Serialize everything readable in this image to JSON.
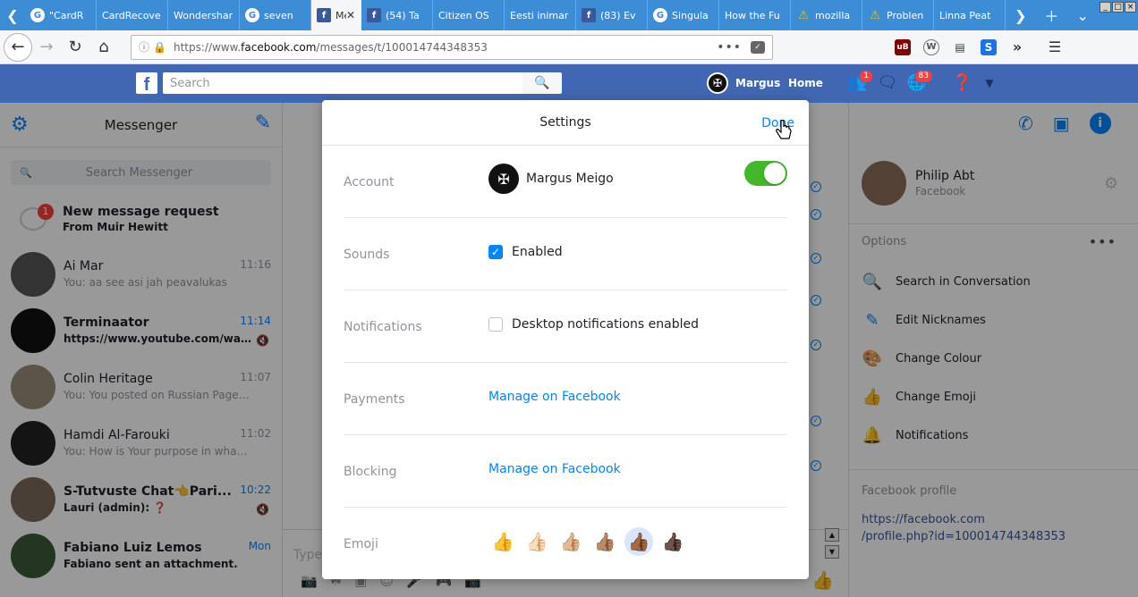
{
  "browser": {
    "tabs": [
      {
        "label": "\"CardR",
        "icon": "google-icon",
        "active": false
      },
      {
        "label": "CardRecove",
        "icon": "",
        "active": false
      },
      {
        "label": "Wondershar",
        "icon": "",
        "active": false
      },
      {
        "label": "seven",
        "icon": "google-icon",
        "active": false
      },
      {
        "label": "Me",
        "icon": "facebook-icon",
        "active": true
      },
      {
        "label": "(54) Ta",
        "icon": "facebook-icon",
        "active": false
      },
      {
        "label": "Citizen OS",
        "icon": "",
        "active": false
      },
      {
        "label": "Eesti inimar",
        "icon": "",
        "active": false
      },
      {
        "label": "(83) Ev",
        "icon": "facebook-icon",
        "active": false
      },
      {
        "label": "Singula",
        "icon": "google-icon",
        "active": false
      },
      {
        "label": "How the Fu",
        "icon": "",
        "active": false
      },
      {
        "label": "mozilla",
        "icon": "warning-icon",
        "active": false
      },
      {
        "label": "Problen",
        "icon": "warning-icon",
        "active": false
      },
      {
        "label": "Linna Peat",
        "icon": "",
        "active": false
      }
    ],
    "url_prefix": "https://www.",
    "url_domain": "facebook.com",
    "url_path": "/messages/t/100014744348353"
  },
  "fb": {
    "search_placeholder": "Search",
    "user_name": "Margus",
    "home_label": "Home",
    "friend_requests_badge": "1",
    "notifications_badge": "83"
  },
  "messenger": {
    "title": "Messenger",
    "search_placeholder": "Search Messenger",
    "request": {
      "badge": "1",
      "title": "New message request",
      "from": "From Muir Hewitt"
    },
    "conversations": [
      {
        "name": "Ai Mar",
        "snippet": "You: aa see asi jah peavalukas",
        "time": "11:16",
        "unread": false,
        "color": "#555"
      },
      {
        "name": "Terminaator",
        "snippet": "https://www.youtube.com/watc...",
        "time": "11:14",
        "unread": true,
        "color": "#111"
      },
      {
        "name": "Colin Heritage",
        "snippet": "You: You posted on Russian Page ...",
        "time": "11:07",
        "unread": false,
        "color": "#9a8a7a"
      },
      {
        "name": "Hamdi Al-Farouki",
        "snippet": "You: How is Your purpose in what ...",
        "time": "11:02",
        "unread": false,
        "color": "#222"
      },
      {
        "name": "S-Tutvuste Chat👈Pari...",
        "snippet": "Lauri (admin): ❓",
        "time": "10:22",
        "unread": true,
        "color": "#7a6a5a"
      },
      {
        "name": "Fabiano Luiz Lemos",
        "snippet": "Fabiano sent an attachment.",
        "time": "Mon",
        "unread": true,
        "color": "#3a5a3a"
      }
    ],
    "composer_placeholder": "Type"
  },
  "settings": {
    "title": "Settings",
    "done_label": "Done",
    "account_label": "Account",
    "account_name": "Margus Meigo",
    "sounds_label": "Sounds",
    "sounds_value": "Enabled",
    "notifications_label": "Notifications",
    "notifications_value": "Desktop notifications enabled",
    "payments_label": "Payments",
    "payments_link": "Manage on Facebook",
    "blocking_label": "Blocking",
    "blocking_link": "Manage on Facebook",
    "emoji_label": "Emoji",
    "emoji_options": [
      "👍",
      "👍🏻",
      "👍🏼",
      "👍🏽",
      "👍🏾",
      "👍🏿"
    ]
  },
  "info_panel": {
    "contact_name": "Philip Abt",
    "contact_sub": "Facebook",
    "options_label": "Options",
    "options": [
      {
        "label": "Search in Conversation",
        "icon": "search-icon"
      },
      {
        "label": "Edit Nicknames",
        "icon": "pencil-icon"
      },
      {
        "label": "Change Colour",
        "icon": "palette-icon"
      },
      {
        "label": "Change Emoji",
        "icon": "thumbs-up-icon"
      },
      {
        "label": "Notifications",
        "icon": "bell-icon"
      }
    ],
    "profile_label": "Facebook profile",
    "profile_link_1": "https://facebook.com",
    "profile_link_2": "/profile.php?id=100014744348353"
  },
  "colors": {
    "fb_blue": "#4267b2",
    "messenger_blue": "#0084ff",
    "toggle_green": "#42b72a",
    "tab_blue": "#3c8dd6"
  }
}
